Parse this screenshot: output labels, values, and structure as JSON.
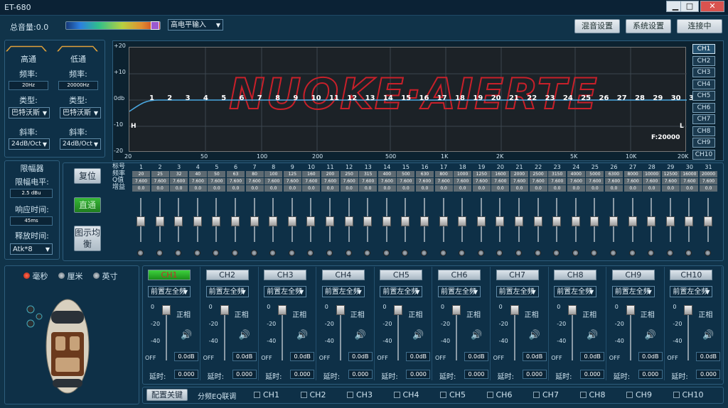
{
  "window": {
    "title": "ET-680",
    "min": "▁",
    "max": "□",
    "close": "✕"
  },
  "topbar": {
    "total_volume": "总音量:0.0",
    "input_select": "高电平输入",
    "mix_btn": "混音设置",
    "sys_btn": "系统设置",
    "conn_btn": "连接中"
  },
  "filters": {
    "highpass": {
      "title": "高通",
      "freq_label": "频率:",
      "freq": "20Hz",
      "type_label": "类型:",
      "type": "巴特沃斯",
      "slope_label": "斜率:",
      "slope": "24dB/Oct"
    },
    "lowpass": {
      "title": "低通",
      "freq_label": "频率:",
      "freq": "20000Hz",
      "type_label": "类型:",
      "type": "巴特沃斯",
      "slope_label": "斜率:",
      "slope": "24dB/Oct"
    }
  },
  "limiter": {
    "title": "限幅器",
    "level_label": "限幅电平:",
    "level": "2.5 dBu",
    "response_label": "响应时间:",
    "response": "45ms",
    "release_label": "释放时间:",
    "release": "Atk*8"
  },
  "graph": {
    "watermark": "NUOKE·AIERTE",
    "y_ticks": [
      "+20",
      "+10",
      "0db",
      "-10",
      "-20"
    ],
    "x_ticks": [
      "20",
      "50",
      "100",
      "200",
      "500",
      "1K",
      "2K",
      "5K",
      "10K",
      "20K"
    ],
    "band_numbers": [
      "1",
      "2",
      "3",
      "4",
      "5",
      "6",
      "7",
      "8",
      "9",
      "10",
      "11",
      "12",
      "13",
      "14",
      "15",
      "16",
      "17",
      "18",
      "19",
      "20",
      "21",
      "22",
      "23",
      "24",
      "25",
      "26",
      "27",
      "28",
      "29",
      "30",
      "31"
    ],
    "h_marker": "H",
    "l_marker": "L",
    "f_readout": "F:20000",
    "ch_tabs": [
      "CH1",
      "CH2",
      "CH3",
      "CH4",
      "CH5",
      "CH6",
      "CH7",
      "CH8",
      "CH9",
      "CH10"
    ]
  },
  "eq": {
    "row_labels": [
      "标号",
      "频率",
      "Q值",
      "增益"
    ],
    "buttons": {
      "reset": "复位",
      "bypass": "直通",
      "graphic_eq": "图示均衡"
    },
    "freqs": [
      "20",
      "25",
      "32",
      "40",
      "50",
      "63",
      "80",
      "100",
      "125",
      "160",
      "200",
      "250",
      "315",
      "400",
      "500",
      "630",
      "800",
      "1000",
      "1250",
      "1600",
      "2000",
      "2500",
      "3150",
      "4000",
      "5000",
      "6300",
      "8000",
      "10000",
      "12500",
      "16000",
      "20000"
    ],
    "q": "7.600",
    "gain": "0.0"
  },
  "units": {
    "ms": "毫秒",
    "cm": "厘米",
    "inch": "英寸"
  },
  "channels": [
    {
      "name": "CH1",
      "pos": "前置左全频"
    },
    {
      "name": "CH2",
      "pos": "前置左全频"
    },
    {
      "name": "CH3",
      "pos": "前置左全频"
    },
    {
      "name": "CH4",
      "pos": "前置左全频"
    },
    {
      "name": "CH5",
      "pos": "前置左全频"
    },
    {
      "name": "CH6",
      "pos": "前置左全频"
    },
    {
      "name": "CH7",
      "pos": "前置左全频"
    },
    {
      "name": "CH8",
      "pos": "前置左全频"
    },
    {
      "name": "CH9",
      "pos": "前置左全频"
    },
    {
      "name": "CH10",
      "pos": "前置左全频"
    }
  ],
  "strip": {
    "scale": [
      "0",
      "-20",
      "-40",
      "OFF"
    ],
    "phase": "正相",
    "gain": "0.0dB",
    "delay_label": "延时:",
    "delay": "0.000"
  },
  "bottom": {
    "config_btn": "配置关键",
    "link_label": "分频EQ联调",
    "link_chs": [
      "CH1",
      "CH2",
      "CH3",
      "CH4",
      "CH5",
      "CH6",
      "CH7",
      "CH8",
      "CH9",
      "CH10"
    ]
  },
  "colors": {
    "accent_orange": "#e2a23a",
    "active_green": "#2fb82f",
    "curve": "#4aa8e0",
    "watermark": "#c8202a"
  }
}
